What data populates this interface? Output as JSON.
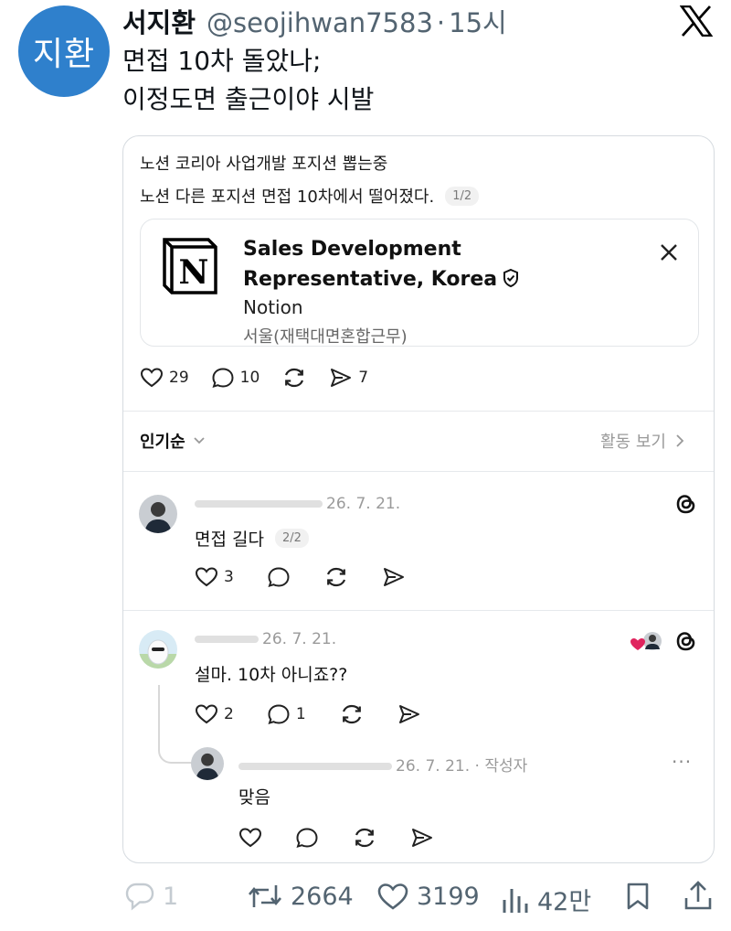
{
  "tweet": {
    "avatar_text": "지환",
    "display_name": "서지환",
    "handle": "@seojihwan7583",
    "separator": "·",
    "time": "15시",
    "body_lines": [
      "면접 10차 돌았나;",
      "이정도면 출근이야 시발"
    ]
  },
  "card": {
    "line1": "노션 코리아 사업개발 포지션 뽑는중",
    "line2": "노션 다른 포지션 면접 10차에서 떨어졌다.",
    "page_indicator": "1/2",
    "job": {
      "title": "Sales Development Representative, Korea",
      "company": "Notion",
      "location": "서울(재택대면혼합근무)",
      "logo_letter": "N"
    },
    "stats": {
      "likes": "29",
      "replies": "10",
      "shares": "7"
    },
    "sort_label": "인기순",
    "activity_label": "활동 보기",
    "comments": [
      {
        "date": "26. 7. 21.",
        "text": "면접 길다",
        "page_indicator": "2/2",
        "likes": "3"
      },
      {
        "date": "26. 7. 21.",
        "text": "설마. 10차 아니죠??",
        "likes": "2",
        "replies": "1"
      },
      {
        "date": "26. 7. 21.",
        "author_tag": "작성자",
        "text": "맞음",
        "more": "···"
      }
    ]
  },
  "footer": {
    "replies": "1",
    "retweets": "2664",
    "likes": "3199",
    "views": "42만"
  },
  "colors": {
    "avatar_bg": "#2f80cc",
    "heart_red": "#e0245e",
    "muted": "#536471"
  },
  "icons": [
    "x-logo-icon",
    "notion-logo-icon",
    "verified-icon",
    "close-icon",
    "heart-icon",
    "reply-icon",
    "repost-icon",
    "share-icon",
    "chevron-down-icon",
    "chevron-right-icon",
    "threads-icon",
    "retweet-icon",
    "views-icon",
    "bookmark-icon",
    "upload-icon"
  ]
}
